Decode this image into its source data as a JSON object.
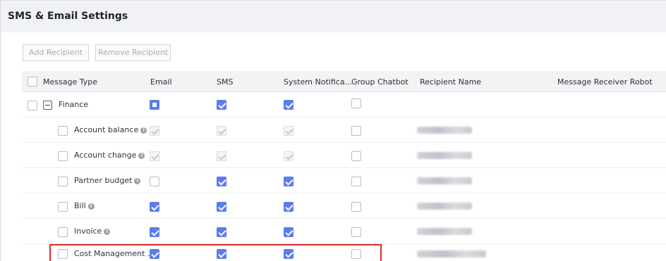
{
  "page": {
    "title": "SMS & Email Settings"
  },
  "toolbar": {
    "add_label": "Add Recipient",
    "remove_label": "Remove Recipient"
  },
  "table": {
    "headers": {
      "message_type": "Message Type",
      "email": "Email",
      "sms": "SMS",
      "system": "System Notifica...",
      "chatbot": "Group Chatbot",
      "recipient": "Recipient Name",
      "robot": "Message Receiver Robot"
    },
    "group": {
      "label": "Finance",
      "email": "partial",
      "sms": "checked",
      "system": "checked",
      "chatbot": "unchecked"
    },
    "rows": [
      {
        "label": "Account balance",
        "email": "disabled",
        "sms": "disabled",
        "system": "disabled",
        "chatbot": "unchecked",
        "recipient_blurred": true
      },
      {
        "label": "Account change",
        "email": "disabled",
        "sms": "disabled",
        "system": "disabled",
        "chatbot": "unchecked",
        "recipient_blurred": true
      },
      {
        "label": "Partner budget",
        "email": "unchecked",
        "sms": "checked",
        "system": "checked",
        "chatbot": "unchecked",
        "recipient_blurred": true
      },
      {
        "label": "Bill",
        "email": "checked",
        "sms": "checked",
        "system": "checked",
        "chatbot": "unchecked",
        "recipient_blurred": true
      },
      {
        "label": "Invoice",
        "email": "checked",
        "sms": "checked",
        "system": "checked",
        "chatbot": "unchecked",
        "recipient_blurred": true
      },
      {
        "label": "Cost Management ...",
        "email": "checked",
        "sms": "checked",
        "system": "checked",
        "chatbot": "unchecked",
        "recipient_blurred": true,
        "highlighted": true
      }
    ]
  },
  "colors": {
    "accent": "#5b7cf0",
    "highlight": "#e02a2a"
  }
}
